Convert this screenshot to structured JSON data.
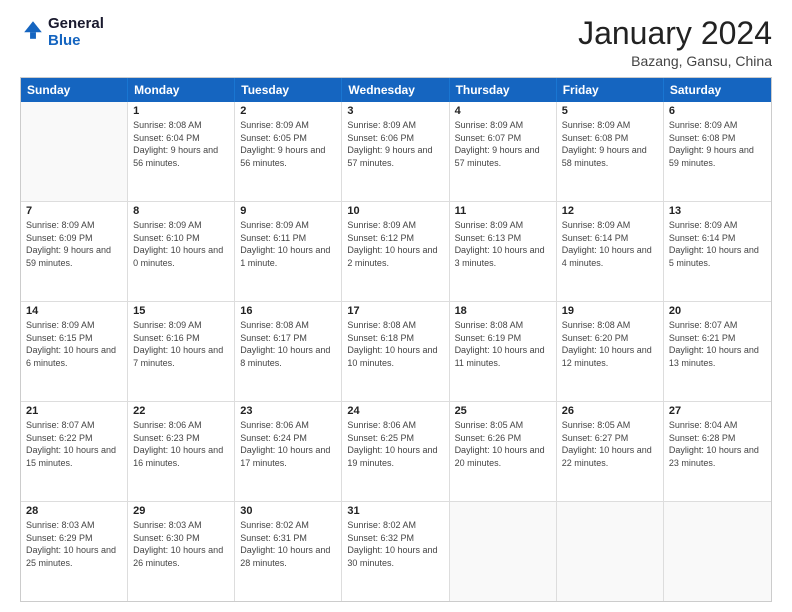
{
  "logo": {
    "line1": "General",
    "line2": "Blue"
  },
  "title": "January 2024",
  "subtitle": "Bazang, Gansu, China",
  "header_days": [
    "Sunday",
    "Monday",
    "Tuesday",
    "Wednesday",
    "Thursday",
    "Friday",
    "Saturday"
  ],
  "weeks": [
    [
      {
        "day": "",
        "sunrise": "",
        "sunset": "",
        "daylight": ""
      },
      {
        "day": "1",
        "sunrise": "Sunrise: 8:08 AM",
        "sunset": "Sunset: 6:04 PM",
        "daylight": "Daylight: 9 hours and 56 minutes."
      },
      {
        "day": "2",
        "sunrise": "Sunrise: 8:09 AM",
        "sunset": "Sunset: 6:05 PM",
        "daylight": "Daylight: 9 hours and 56 minutes."
      },
      {
        "day": "3",
        "sunrise": "Sunrise: 8:09 AM",
        "sunset": "Sunset: 6:06 PM",
        "daylight": "Daylight: 9 hours and 57 minutes."
      },
      {
        "day": "4",
        "sunrise": "Sunrise: 8:09 AM",
        "sunset": "Sunset: 6:07 PM",
        "daylight": "Daylight: 9 hours and 57 minutes."
      },
      {
        "day": "5",
        "sunrise": "Sunrise: 8:09 AM",
        "sunset": "Sunset: 6:08 PM",
        "daylight": "Daylight: 9 hours and 58 minutes."
      },
      {
        "day": "6",
        "sunrise": "Sunrise: 8:09 AM",
        "sunset": "Sunset: 6:08 PM",
        "daylight": "Daylight: 9 hours and 59 minutes."
      }
    ],
    [
      {
        "day": "7",
        "sunrise": "Sunrise: 8:09 AM",
        "sunset": "Sunset: 6:09 PM",
        "daylight": "Daylight: 9 hours and 59 minutes."
      },
      {
        "day": "8",
        "sunrise": "Sunrise: 8:09 AM",
        "sunset": "Sunset: 6:10 PM",
        "daylight": "Daylight: 10 hours and 0 minutes."
      },
      {
        "day": "9",
        "sunrise": "Sunrise: 8:09 AM",
        "sunset": "Sunset: 6:11 PM",
        "daylight": "Daylight: 10 hours and 1 minute."
      },
      {
        "day": "10",
        "sunrise": "Sunrise: 8:09 AM",
        "sunset": "Sunset: 6:12 PM",
        "daylight": "Daylight: 10 hours and 2 minutes."
      },
      {
        "day": "11",
        "sunrise": "Sunrise: 8:09 AM",
        "sunset": "Sunset: 6:13 PM",
        "daylight": "Daylight: 10 hours and 3 minutes."
      },
      {
        "day": "12",
        "sunrise": "Sunrise: 8:09 AM",
        "sunset": "Sunset: 6:14 PM",
        "daylight": "Daylight: 10 hours and 4 minutes."
      },
      {
        "day": "13",
        "sunrise": "Sunrise: 8:09 AM",
        "sunset": "Sunset: 6:14 PM",
        "daylight": "Daylight: 10 hours and 5 minutes."
      }
    ],
    [
      {
        "day": "14",
        "sunrise": "Sunrise: 8:09 AM",
        "sunset": "Sunset: 6:15 PM",
        "daylight": "Daylight: 10 hours and 6 minutes."
      },
      {
        "day": "15",
        "sunrise": "Sunrise: 8:09 AM",
        "sunset": "Sunset: 6:16 PM",
        "daylight": "Daylight: 10 hours and 7 minutes."
      },
      {
        "day": "16",
        "sunrise": "Sunrise: 8:08 AM",
        "sunset": "Sunset: 6:17 PM",
        "daylight": "Daylight: 10 hours and 8 minutes."
      },
      {
        "day": "17",
        "sunrise": "Sunrise: 8:08 AM",
        "sunset": "Sunset: 6:18 PM",
        "daylight": "Daylight: 10 hours and 10 minutes."
      },
      {
        "day": "18",
        "sunrise": "Sunrise: 8:08 AM",
        "sunset": "Sunset: 6:19 PM",
        "daylight": "Daylight: 10 hours and 11 minutes."
      },
      {
        "day": "19",
        "sunrise": "Sunrise: 8:08 AM",
        "sunset": "Sunset: 6:20 PM",
        "daylight": "Daylight: 10 hours and 12 minutes."
      },
      {
        "day": "20",
        "sunrise": "Sunrise: 8:07 AM",
        "sunset": "Sunset: 6:21 PM",
        "daylight": "Daylight: 10 hours and 13 minutes."
      }
    ],
    [
      {
        "day": "21",
        "sunrise": "Sunrise: 8:07 AM",
        "sunset": "Sunset: 6:22 PM",
        "daylight": "Daylight: 10 hours and 15 minutes."
      },
      {
        "day": "22",
        "sunrise": "Sunrise: 8:06 AM",
        "sunset": "Sunset: 6:23 PM",
        "daylight": "Daylight: 10 hours and 16 minutes."
      },
      {
        "day": "23",
        "sunrise": "Sunrise: 8:06 AM",
        "sunset": "Sunset: 6:24 PM",
        "daylight": "Daylight: 10 hours and 17 minutes."
      },
      {
        "day": "24",
        "sunrise": "Sunrise: 8:06 AM",
        "sunset": "Sunset: 6:25 PM",
        "daylight": "Daylight: 10 hours and 19 minutes."
      },
      {
        "day": "25",
        "sunrise": "Sunrise: 8:05 AM",
        "sunset": "Sunset: 6:26 PM",
        "daylight": "Daylight: 10 hours and 20 minutes."
      },
      {
        "day": "26",
        "sunrise": "Sunrise: 8:05 AM",
        "sunset": "Sunset: 6:27 PM",
        "daylight": "Daylight: 10 hours and 22 minutes."
      },
      {
        "day": "27",
        "sunrise": "Sunrise: 8:04 AM",
        "sunset": "Sunset: 6:28 PM",
        "daylight": "Daylight: 10 hours and 23 minutes."
      }
    ],
    [
      {
        "day": "28",
        "sunrise": "Sunrise: 8:03 AM",
        "sunset": "Sunset: 6:29 PM",
        "daylight": "Daylight: 10 hours and 25 minutes."
      },
      {
        "day": "29",
        "sunrise": "Sunrise: 8:03 AM",
        "sunset": "Sunset: 6:30 PM",
        "daylight": "Daylight: 10 hours and 26 minutes."
      },
      {
        "day": "30",
        "sunrise": "Sunrise: 8:02 AM",
        "sunset": "Sunset: 6:31 PM",
        "daylight": "Daylight: 10 hours and 28 minutes."
      },
      {
        "day": "31",
        "sunrise": "Sunrise: 8:02 AM",
        "sunset": "Sunset: 6:32 PM",
        "daylight": "Daylight: 10 hours and 30 minutes."
      },
      {
        "day": "",
        "sunrise": "",
        "sunset": "",
        "daylight": ""
      },
      {
        "day": "",
        "sunrise": "",
        "sunset": "",
        "daylight": ""
      },
      {
        "day": "",
        "sunrise": "",
        "sunset": "",
        "daylight": ""
      }
    ]
  ]
}
